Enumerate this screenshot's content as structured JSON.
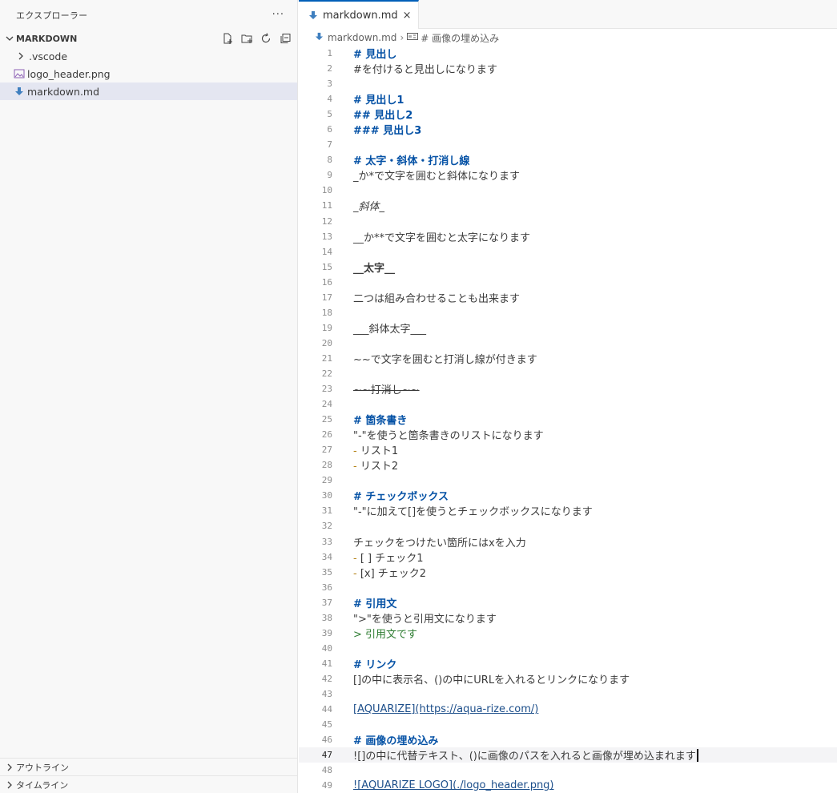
{
  "sidebar": {
    "title": "エクスプローラー",
    "more": "···",
    "folder": "MARKDOWN",
    "items": [
      {
        "label": ".vscode",
        "kind": "folder",
        "icon": "chevron-right-icon"
      },
      {
        "label": "logo_header.png",
        "kind": "image",
        "icon": "image-file-icon"
      },
      {
        "label": "markdown.md",
        "kind": "markdown",
        "icon": "markdown-file-icon",
        "selected": true
      }
    ],
    "panels": [
      {
        "label": "アウトライン"
      },
      {
        "label": "タイムライン"
      }
    ]
  },
  "editor": {
    "tab_label": "markdown.md",
    "tab_close": "×",
    "breadcrumb": {
      "file": "markdown.md",
      "separator": "›",
      "symbol": "# 画像の埋め込み"
    },
    "current_line": 47,
    "lines": [
      {
        "n": "1",
        "t": "# 見出し",
        "s": "h"
      },
      {
        "n": "2",
        "t": "#を付けると見出しになります",
        "s": ""
      },
      {
        "n": "3",
        "t": "",
        "s": ""
      },
      {
        "n": "4",
        "t": "# 見出し1",
        "s": "h"
      },
      {
        "n": "5",
        "t": "## 見出し2",
        "s": "h"
      },
      {
        "n": "6",
        "t": "### 見出し3",
        "s": "h"
      },
      {
        "n": "7",
        "t": "",
        "s": ""
      },
      {
        "n": "8",
        "t": "# 太字・斜体・打消し線",
        "s": "h"
      },
      {
        "n": "9",
        "t": "_か*で文字を囲むと斜体になります",
        "s": ""
      },
      {
        "n": "10",
        "t": "",
        "s": ""
      },
      {
        "n": "11",
        "t": "_斜体_",
        "s": "ital"
      },
      {
        "n": "12",
        "t": "",
        "s": ""
      },
      {
        "n": "13",
        "t": "__か**で文字を囲むと太字になります",
        "s": ""
      },
      {
        "n": "14",
        "t": "",
        "s": ""
      },
      {
        "n": "15",
        "t": "__太字__",
        "s": "bold"
      },
      {
        "n": "16",
        "t": "",
        "s": ""
      },
      {
        "n": "17",
        "t": "二つは組み合わせることも出来ます",
        "s": ""
      },
      {
        "n": "18",
        "t": "",
        "s": ""
      },
      {
        "n": "19",
        "t": "___斜体太字___",
        "s": ""
      },
      {
        "n": "20",
        "t": "",
        "s": ""
      },
      {
        "n": "21",
        "t": "~~で文字を囲むと打消し線が付きます",
        "s": ""
      },
      {
        "n": "22",
        "t": "",
        "s": ""
      },
      {
        "n": "23",
        "t": "~~打消し~~",
        "s": "strike"
      },
      {
        "n": "24",
        "t": "",
        "s": ""
      },
      {
        "n": "25",
        "t": "# 箇条書き",
        "s": "h"
      },
      {
        "n": "26",
        "t": "\"-\"を使うと箇条書きのリストになります",
        "s": ""
      },
      {
        "n": "27",
        "t": "リスト1",
        "s": "bullet"
      },
      {
        "n": "28",
        "t": "リスト2",
        "s": "bullet"
      },
      {
        "n": "29",
        "t": "",
        "s": ""
      },
      {
        "n": "30",
        "t": "# チェックボックス",
        "s": "h"
      },
      {
        "n": "31",
        "t": "\"-\"に加えて[]を使うとチェックボックスになります",
        "s": ""
      },
      {
        "n": "32",
        "t": "",
        "s": ""
      },
      {
        "n": "33",
        "t": "チェックをつけたい箇所にはxを入力",
        "s": ""
      },
      {
        "n": "34",
        "t": "[ ] チェック1",
        "s": "bullet"
      },
      {
        "n": "35",
        "t": "[x] チェック2",
        "s": "bullet"
      },
      {
        "n": "36",
        "t": "",
        "s": ""
      },
      {
        "n": "37",
        "t": "# 引用文",
        "s": "h"
      },
      {
        "n": "38",
        "t": "\">\"を使うと引用文になります",
        "s": ""
      },
      {
        "n": "39",
        "t": "> 引用文です",
        "s": "quote"
      },
      {
        "n": "40",
        "t": "",
        "s": ""
      },
      {
        "n": "41",
        "t": "# リンク",
        "s": "h"
      },
      {
        "n": "42",
        "t": "[]の中に表示名、()の中にURLを入れるとリンクになります",
        "s": ""
      },
      {
        "n": "43",
        "t": "",
        "s": ""
      },
      {
        "n": "44",
        "t": "[AQUARIZE](https://aqua-rize.com/)",
        "s": "link"
      },
      {
        "n": "45",
        "t": "",
        "s": ""
      },
      {
        "n": "46",
        "t": "# 画像の埋め込み",
        "s": "h"
      },
      {
        "n": "47",
        "t": "![]の中に代替テキスト、()に画像のパスを入れると画像が埋め込まれます",
        "s": "current"
      },
      {
        "n": "48",
        "t": "",
        "s": ""
      },
      {
        "n": "49",
        "t": "![AQUARIZE LOGO](./logo_header.png)",
        "s": "link"
      }
    ]
  },
  "colors": {
    "accent": "#005fb8",
    "heading": "#0451a5",
    "bullet": "#b5841a",
    "quote": "#2e7d32",
    "selection": "#e4e6f1"
  }
}
